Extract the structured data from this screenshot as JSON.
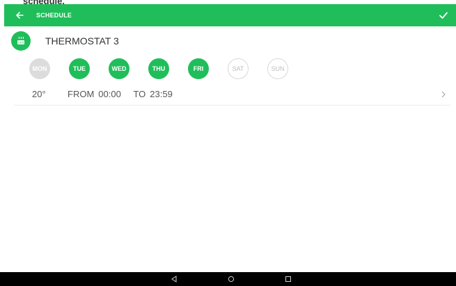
{
  "page_label": "schedule.",
  "appbar": {
    "title": "SCHEDULE",
    "back_icon": "arrow-left-icon",
    "confirm_icon": "check-icon",
    "color": "#1fbe5a"
  },
  "device": {
    "name": "THERMOSTAT 3",
    "icon": "heater-icon"
  },
  "days": [
    {
      "label": "MON",
      "state": "disabled"
    },
    {
      "label": "TUE",
      "state": "selected"
    },
    {
      "label": "WED",
      "state": "selected"
    },
    {
      "label": "THU",
      "state": "selected"
    },
    {
      "label": "FRI",
      "state": "selected"
    },
    {
      "label": "SAT",
      "state": "unselected"
    },
    {
      "label": "SUN",
      "state": "unselected"
    }
  ],
  "schedule": {
    "temperature": "20°",
    "from_label": "FROM",
    "from_time": "00:00",
    "to_label": "TO",
    "to_time": "23:59"
  },
  "navbar": {
    "back_icon": "nav-back-icon",
    "home_icon": "nav-home-icon",
    "recents_icon": "nav-recents-icon"
  }
}
